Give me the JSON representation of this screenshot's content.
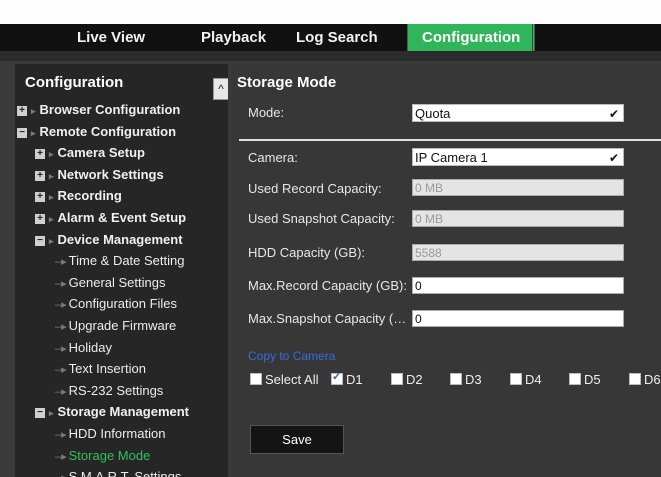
{
  "nav": {
    "tabs": [
      {
        "label": "Live View"
      },
      {
        "label": "Playback"
      },
      {
        "label": "Log Search"
      },
      {
        "label": "Configuration",
        "active": true
      }
    ]
  },
  "sidebar": {
    "title": "Configuration",
    "items": [
      {
        "label": "Browser Configuration",
        "level": 0,
        "toggle": "+"
      },
      {
        "label": "Remote Configuration",
        "level": 0,
        "toggle": "-"
      },
      {
        "label": "Camera Setup",
        "level": 1,
        "toggle": "+"
      },
      {
        "label": "Network Settings",
        "level": 1,
        "toggle": "+"
      },
      {
        "label": "Recording",
        "level": 1,
        "toggle": "+"
      },
      {
        "label": "Alarm & Event Setup",
        "level": 1,
        "toggle": "+"
      },
      {
        "label": "Device Management",
        "level": 1,
        "toggle": "-"
      },
      {
        "label": "Time & Date Setting",
        "level": 2
      },
      {
        "label": "General Settings",
        "level": 2
      },
      {
        "label": "Configuration Files",
        "level": 2
      },
      {
        "label": "Upgrade Firmware",
        "level": 2
      },
      {
        "label": "Holiday",
        "level": 2
      },
      {
        "label": "Text Insertion",
        "level": 2
      },
      {
        "label": "RS-232 Settings",
        "level": 2
      },
      {
        "label": "Storage Management",
        "level": 1,
        "toggle": "-"
      },
      {
        "label": "HDD Information",
        "level": 2
      },
      {
        "label": "Storage Mode",
        "level": 2,
        "selected": true
      },
      {
        "label": "S.M.A.R.T. Settings",
        "level": 2
      }
    ]
  },
  "main": {
    "title": "Storage Mode",
    "mode_label": "Mode:",
    "mode_value": "Quota",
    "camera_label": "Camera:",
    "camera_value": "IP Camera 1",
    "used_record_label": "Used Record Capacity:",
    "used_record_value": "0 MB",
    "used_snapshot_label": "Used Snapshot Capacity:",
    "used_snapshot_value": "0 MB",
    "hdd_capacity_label": "HDD Capacity (GB):",
    "hdd_capacity_value": "5588",
    "max_record_label": "Max.Record Capacity (GB):",
    "max_record_value": "0",
    "max_snapshot_label": "Max.Snapshot Capacity (…",
    "max_snapshot_value": "0",
    "copy_to_camera": "Copy to Camera",
    "copy_options": [
      {
        "label": "Select All",
        "checked": false
      },
      {
        "label": "D1",
        "checked": true
      },
      {
        "label": "D2",
        "checked": false
      },
      {
        "label": "D3",
        "checked": false
      },
      {
        "label": "D4",
        "checked": false
      },
      {
        "label": "D5",
        "checked": false
      },
      {
        "label": "D6",
        "checked": false
      }
    ],
    "save_label": "Save"
  },
  "colors": {
    "accent": "#2fb55a",
    "link": "#3a6bd8",
    "background": "#373737"
  }
}
